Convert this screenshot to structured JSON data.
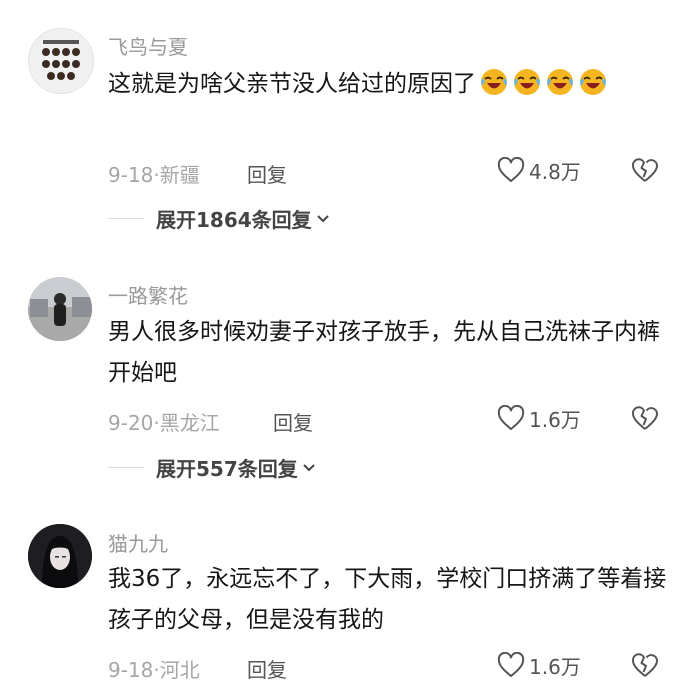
{
  "comments": [
    {
      "username": "飞鸟与夏",
      "text": "这就是为啥父亲节没人给过的原因了",
      "emoji_icon": "loudly-crying-face-icon",
      "emoji_count": 4,
      "date": "9-18",
      "location": "新疆",
      "reply_label": "回复",
      "likes": "4.8万",
      "expand_replies": "展开1864条回复"
    },
    {
      "username": "一路繁花",
      "text": "男人很多时候劝妻子对孩子放手，先从自己洗袜子内裤开始吧",
      "date": "9-20",
      "location": "黑龙江",
      "reply_label": "回复",
      "likes": "1.6万",
      "expand_replies": "展开557条回复"
    },
    {
      "username": "猫九九",
      "text": "我36了，永远忘不了，下大雨，学校门口挤满了等着接孩子的父母，但是没有我的",
      "date": "9-18",
      "location": "河北",
      "reply_label": "回复",
      "likes": "1.6万"
    }
  ],
  "meta_separator": "·",
  "colors": {
    "username": "#9a9a9a",
    "text": "#161616",
    "meta": "#a6a6a6",
    "action": "#555555",
    "emoji_face": "#f5b521"
  }
}
